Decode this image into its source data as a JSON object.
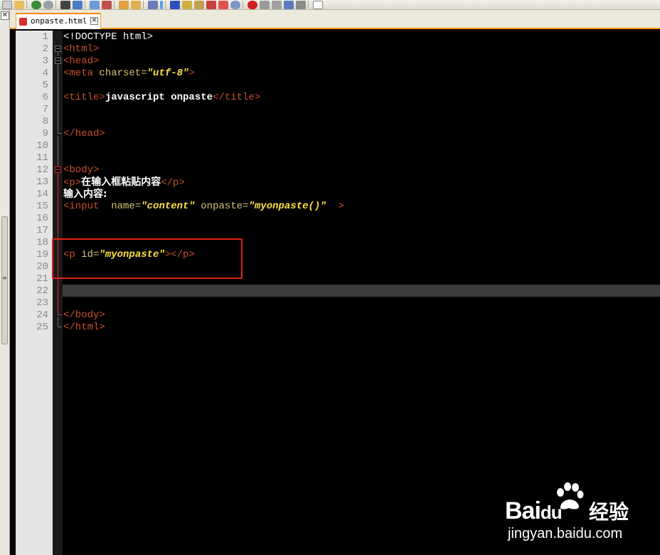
{
  "tab": {
    "filename": "onpaste.html",
    "close_glyph": "✕"
  },
  "left_panel": {
    "close_glyph": "✕",
    "grip_glyph": "≡"
  },
  "toolbar": {
    "icons": [
      "new-file-icon",
      "open-file-icon",
      "undo-icon",
      "redo-icon",
      "find-icon",
      "find-next-icon",
      "replace-icon",
      "copy-icon",
      "paste-icon",
      "zoom-icon",
      "wrap-icon",
      "indent-icon",
      "bookmark-icon",
      "browser-icon",
      "macro-icon",
      "run-icon",
      "plugin-icon",
      "record-icon",
      "stop-icon",
      "play-icon",
      "save-macro-icon",
      "settings-icon"
    ]
  },
  "editor": {
    "line_numbers": [
      "1",
      "2",
      "3",
      "4",
      "5",
      "6",
      "7",
      "8",
      "9",
      "10",
      "11",
      "12",
      "13",
      "14",
      "15",
      "16",
      "17",
      "18",
      "19",
      "20",
      "21",
      "22",
      "23",
      "24",
      "25"
    ],
    "current_line": 22,
    "highlighted_lines": [
      19,
      20
    ],
    "code": {
      "l1_doctype": "<!DOCTYPE html>",
      "l2_html_open": "<html>",
      "l3_head_open": "<head>",
      "l4_meta_open": "<meta",
      "l4_attr": " charset=",
      "l4_value": "\"utf-8\"",
      "l4_close": ">",
      "l6_title_open": "<title>",
      "l6_text": "javascript onpaste",
      "l6_title_close": "</title>",
      "l9_head_close": "</head>",
      "l12_body_open": "<body>",
      "l13_p_open": "<p>",
      "l13_text": "在输入框粘贴内容",
      "l13_p_close": "</p>",
      "l14_text": "输入内容:",
      "l15_input_open": "<input",
      "l15_attr_name": "  name=",
      "l15_value_name": "\"content\"",
      "l15_attr_onpaste": " onpaste=",
      "l15_value_onpaste": "\"myonpaste()\"",
      "l15_close": "  >",
      "l19_p_open": "<p",
      "l19_attr_id": " id=",
      "l19_value_id": "\"myonpaste\"",
      "l19_close": "></p>",
      "l24_body_close": "</body>",
      "l25_html_close": "</html>"
    }
  },
  "watermark": {
    "logo_text": "Bai",
    "logo_suffix": "du",
    "cn_text": "经验",
    "url": "jingyan.baidu.com"
  },
  "colors": {
    "tag": "#c8502a",
    "attribute": "#d8c47a",
    "string": "#ffe040",
    "text": "#ffffff",
    "highlight_box": "#e0201a",
    "active_tab_accent": "#f08a00"
  }
}
